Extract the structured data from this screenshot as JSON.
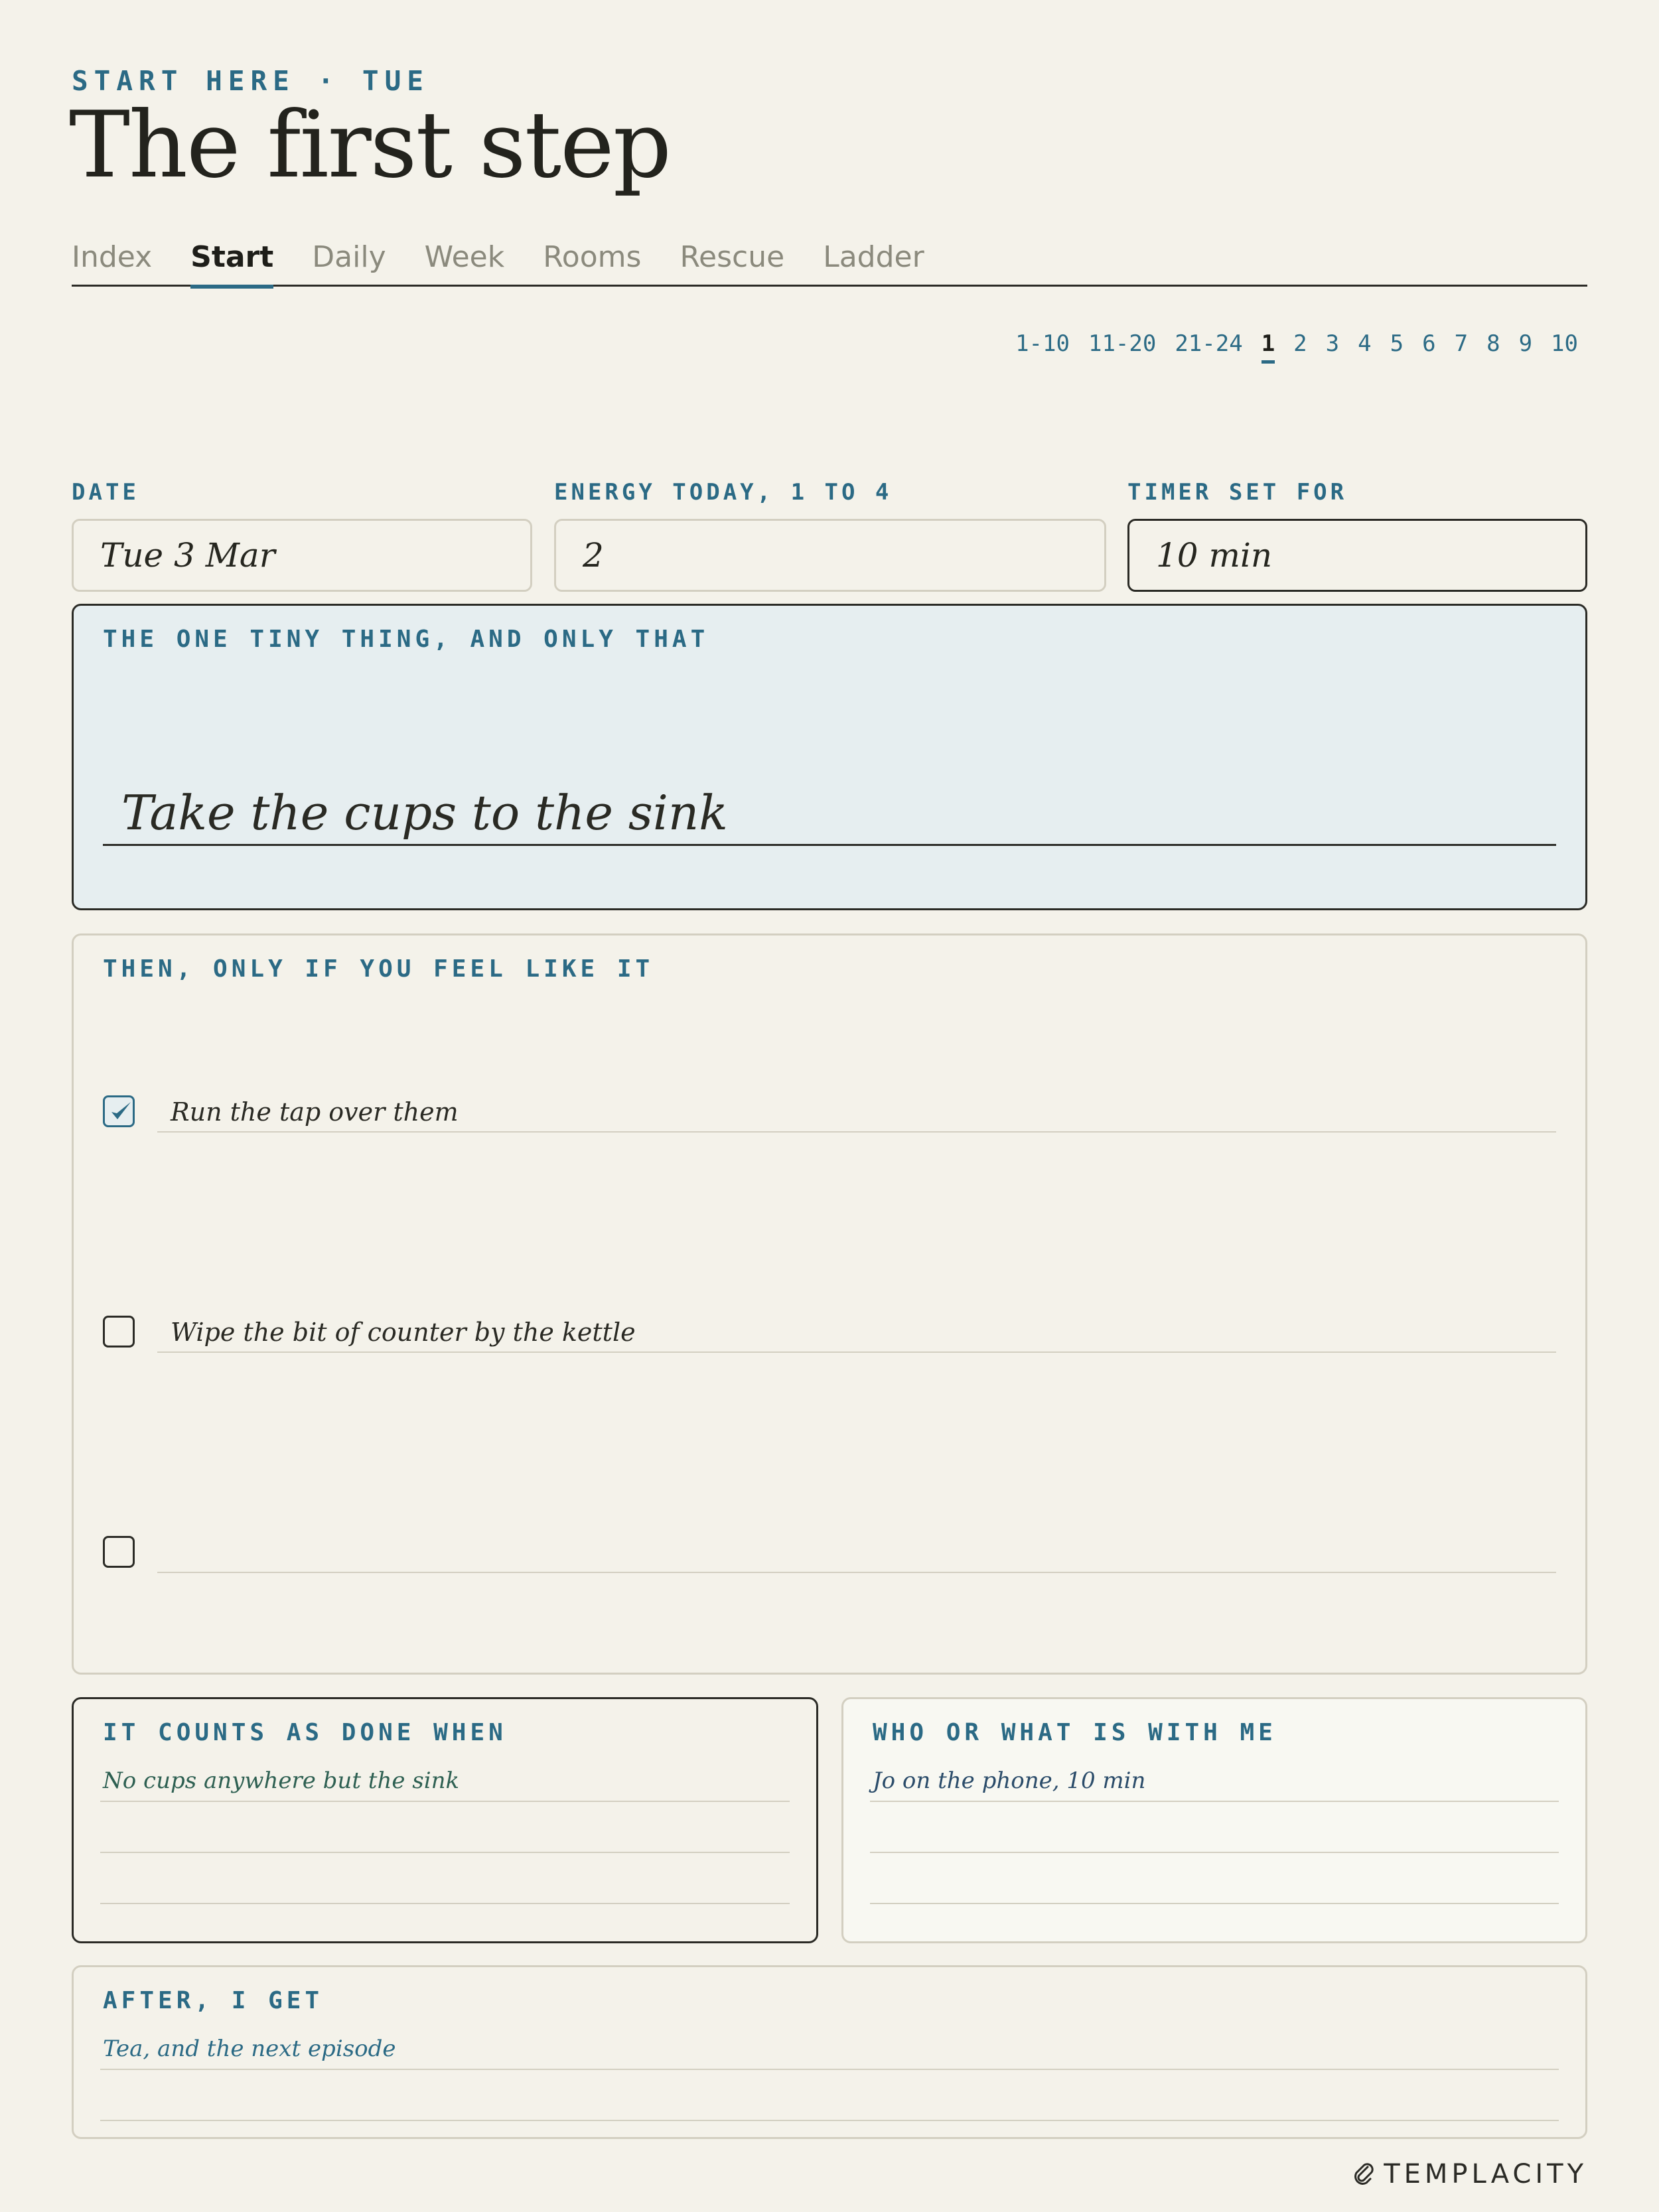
{
  "header": {
    "eyebrow": "START HERE · TUE",
    "title": "The first step"
  },
  "tabs": [
    {
      "label": "Index",
      "active": false
    },
    {
      "label": "Start",
      "active": true
    },
    {
      "label": "Daily",
      "active": false
    },
    {
      "label": "Week",
      "active": false
    },
    {
      "label": "Rooms",
      "active": false
    },
    {
      "label": "Rescue",
      "active": false
    },
    {
      "label": "Ladder",
      "active": false
    }
  ],
  "pager": {
    "items": [
      "1-10",
      "11-20",
      "21-24",
      "1",
      "2",
      "3",
      "4",
      "5",
      "6",
      "7",
      "8",
      "9",
      "10"
    ],
    "current": "1"
  },
  "fields": {
    "date": {
      "label": "DATE",
      "value": "Tue 3 Mar"
    },
    "energy": {
      "label": "ENERGY TODAY, 1 TO 4",
      "value": "2"
    },
    "timer": {
      "label": "TIMER SET FOR",
      "value": "10 min"
    }
  },
  "one_thing": {
    "label": "THE ONE TINY THING, AND ONLY THAT",
    "value": "Take the cups to the sink"
  },
  "then": {
    "label": "THEN, ONLY IF YOU FEEL LIKE IT",
    "items": [
      {
        "text": "Run the tap over them",
        "checked": true
      },
      {
        "text": "Wipe the bit of counter by the kettle",
        "checked": false
      },
      {
        "text": "",
        "checked": false
      }
    ]
  },
  "done_when": {
    "label": "IT COUNTS AS DONE WHEN",
    "entry": "No cups anywhere but the sink"
  },
  "with_me": {
    "label": "WHO OR WHAT IS WITH ME",
    "entry": "Jo on the phone, 10 min"
  },
  "after": {
    "label": "AFTER, I GET",
    "entry": "Tea, and the next episode"
  },
  "brand": {
    "name": "TEMPLACITY",
    "icon": "paperclip-icon"
  },
  "colors": {
    "background": "#f4f2ea",
    "accent": "#2b6a85",
    "ink": "#23231d",
    "highlight_panel": "#e6eef0"
  }
}
